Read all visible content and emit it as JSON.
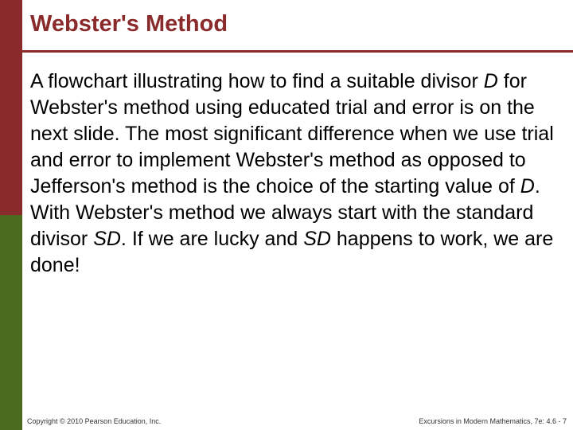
{
  "sidebar": {
    "top_color": "#8a2a2a",
    "bottom_color": "#4b6b1f"
  },
  "header": {
    "title": "Webster's Method"
  },
  "body": {
    "p1_a": "A flowchart illustrating how to find a suitable divisor ",
    "p1_D": "D",
    "p1_b": " for Webster's method using educated trial and error is on the next slide. The most significant difference when we use trial and error to implement Webster's method as opposed to Jefferson's method is the choice of the starting value of ",
    "p1_D2": "D",
    "p1_c": ". With Webster's method we always start with the standard divisor ",
    "p1_SD": "SD",
    "p1_d": ". If we are lucky and ",
    "p1_SD2": "SD",
    "p1_e": " happens to work, we are done!"
  },
  "footer": {
    "copyright": "Copyright © 2010 Pearson Education, Inc.",
    "right": "Excursions in Modern Mathematics, 7e: 4.6 - 7"
  }
}
